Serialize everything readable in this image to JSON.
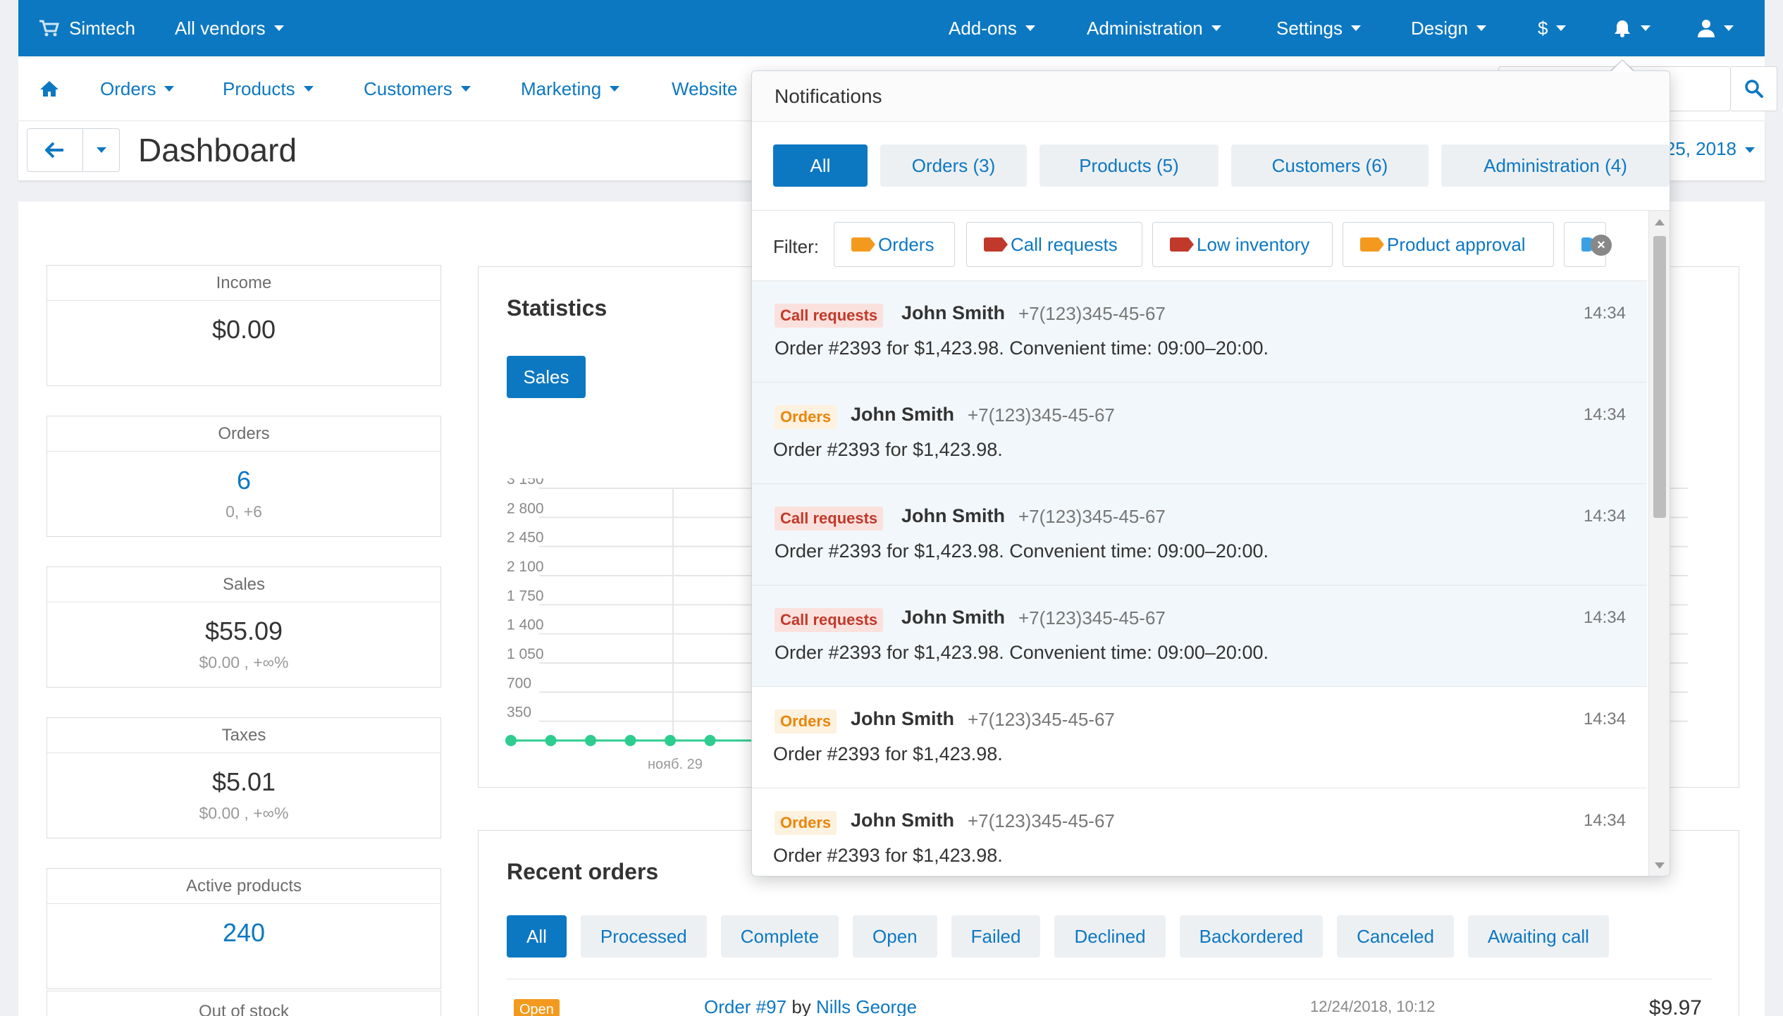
{
  "topbar": {
    "brand": "Simtech",
    "vendor_menu": "All vendors",
    "menus": [
      "Add-ons",
      "Administration",
      "Settings",
      "Design",
      "$"
    ]
  },
  "subnav": {
    "items": [
      "Orders",
      "Products",
      "Customers",
      "Marketing",
      "Website"
    ]
  },
  "page": {
    "title": "Dashboard",
    "date_range": "25, 2018"
  },
  "cards": [
    {
      "title": "Income",
      "value": "$0.00",
      "sub": ""
    },
    {
      "title": "Orders",
      "value": "6",
      "sub": "0, +6"
    },
    {
      "title": "Sales",
      "value": "$55.09",
      "sub": "$0.00 , +∞%"
    },
    {
      "title": "Taxes",
      "value": "$5.01",
      "sub": "$0.00 , +∞%"
    },
    {
      "title": "Active products",
      "value": "240",
      "sub": ""
    },
    {
      "title": "Out of stock",
      "value": "",
      "sub": ""
    }
  ],
  "statistics": {
    "title": "Statistics",
    "sales_button": "Sales"
  },
  "chart_data": {
    "type": "line",
    "y_ticks": [
      "3 150",
      "2 800",
      "2 450",
      "2 100",
      "1 750",
      "1 400",
      "1 050",
      "700",
      "350"
    ],
    "x_tick_label": "нояб. 29",
    "ylim": [
      0,
      3150
    ],
    "series": [
      {
        "values": [
          0,
          0,
          0,
          0,
          0,
          0
        ]
      }
    ],
    "colors": {
      "line": "#2ecc8f",
      "grid": "#e6e6e6"
    }
  },
  "recent_orders": {
    "title": "Recent orders",
    "tabs": [
      "All",
      "Processed",
      "Complete",
      "Open",
      "Failed",
      "Declined",
      "Backordered",
      "Canceled",
      "Awaiting call"
    ],
    "row": {
      "status": "Open",
      "order": "Order #97",
      "by": "by",
      "customer": "Nills George",
      "date": "12/24/2018, 10:12",
      "total": "$9.97"
    }
  },
  "notifications": {
    "title": "Notifications",
    "tabs": [
      "All",
      "Orders (3)",
      "Products (5)",
      "Customers (6)",
      "Administration (4)"
    ],
    "filter_label": "Filter:",
    "filters": [
      "Orders",
      "Call requests",
      "Low inventory",
      "Product approval"
    ],
    "items": [
      {
        "badge": "Call requests",
        "kind": "call",
        "name": "John Smith",
        "phone": "+7(123)345-45-67",
        "time": "14:34",
        "message": "Order #2393 for $1,423.98. Convenient time: 09:00–20:00.",
        "unread": true
      },
      {
        "badge": "Orders",
        "kind": "orders",
        "name": "John Smith",
        "phone": "+7(123)345-45-67",
        "time": "14:34",
        "message": "Order #2393 for $1,423.98.",
        "unread": true
      },
      {
        "badge": "Call requests",
        "kind": "call",
        "name": "John Smith",
        "phone": "+7(123)345-45-67",
        "time": "14:34",
        "message": "Order #2393 for $1,423.98. Convenient time: 09:00–20:00.",
        "unread": true
      },
      {
        "badge": "Call requests",
        "kind": "call",
        "name": "John Smith",
        "phone": "+7(123)345-45-67",
        "time": "14:34",
        "message": "Order #2393 for $1,423.98. Convenient time: 09:00–20:00.",
        "unread": true
      },
      {
        "badge": "Orders",
        "kind": "orders",
        "name": "John Smith",
        "phone": "+7(123)345-45-67",
        "time": "14:34",
        "message": "Order #2393 for $1,423.98.",
        "unread": false
      },
      {
        "badge": "Orders",
        "kind": "orders",
        "name": "John Smith",
        "phone": "+7(123)345-45-67",
        "time": "14:34",
        "message": "Order #2393 for $1,423.98.",
        "unread": false
      }
    ]
  },
  "colors": {
    "brand": "#0d78c2",
    "call_badge": "#c0392b",
    "orders_badge": "#e8860c"
  }
}
